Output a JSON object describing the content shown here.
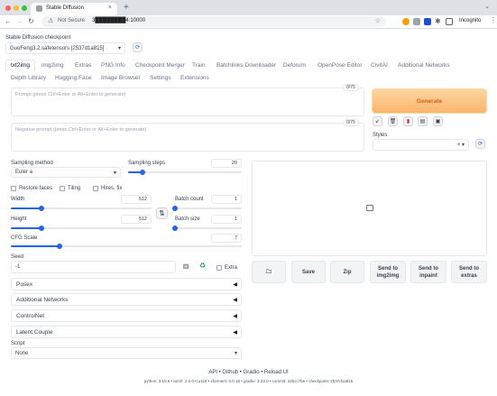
{
  "browser": {
    "tab_title": "Stable Diffusion",
    "tab_close": "×",
    "new_tab": "+",
    "security_label": "Not Secure",
    "url": "3████████4:10000",
    "profile": "Incognito",
    "icons": [
      "back-icon",
      "forward-icon",
      "reload-icon",
      "star-icon",
      "extension-icon",
      "menu-icon"
    ]
  },
  "checkpoint": {
    "label": "Stable Diffusion checkpoint",
    "value": "GuoFeng3.2.safetensors [2537d1a815]"
  },
  "tabs": {
    "row1": [
      "txt2img",
      "img2img",
      "Extras",
      "PNG Info",
      "Checkpoint Merger",
      "Train",
      "Batchlinks Downloader",
      "Deforum",
      "OpenPose Editor",
      "CivitAI",
      "Additional Networks"
    ],
    "row2": [
      "Depth Library",
      "Hugging Face",
      "Image Browser",
      "Settings",
      "Extensions"
    ],
    "active": "txt2img"
  },
  "prompt": {
    "placeholder": "Prompt (press Ctrl+Enter or Alt+Enter to generate)",
    "counter": "0/75"
  },
  "negative_prompt": {
    "placeholder": "Negative prompt (press Ctrl+Enter or Alt+Enter to generate)",
    "counter": "0/75"
  },
  "generate_label": "Generate",
  "styles": {
    "label": "Styles",
    "clear": "×",
    "arrow": "▾"
  },
  "sampling": {
    "method_label": "Sampling method",
    "method_value": "Euler a",
    "steps_label": "Sampling steps",
    "steps_value": "20",
    "steps_fraction": 0.13
  },
  "options": {
    "restore_faces": "Restore faces",
    "tiling": "Tiling",
    "hires_fix": "Hires. fix"
  },
  "size": {
    "width_label": "Width",
    "width_value": "512",
    "width_fraction": 0.22,
    "height_label": "Height",
    "height_value": "512",
    "height_fraction": 0.22,
    "swap_icon": "⇅"
  },
  "batch": {
    "count_label": "Batch count",
    "count_value": "1",
    "count_fraction": 0.0,
    "size_label": "Batch size",
    "size_value": "1",
    "size_fraction": 0.0
  },
  "cfg": {
    "label": "CFG Scale",
    "value": "7",
    "fraction": 0.21
  },
  "seed": {
    "label": "Seed",
    "value": "-1",
    "extra_label": "Extra"
  },
  "accordions": [
    "Posex",
    "Additional Networks",
    "ControlNet",
    "Latent Couple"
  ],
  "accordion_arrow": "◀",
  "script": {
    "label": "Script",
    "value": "None"
  },
  "actions": {
    "save": "Save",
    "zip": "Zip",
    "send_img2img": "Send to img2img",
    "send_inpaint": "Send to inpaint",
    "send_extras": "Send to extras"
  },
  "footer": {
    "links": "API  •  Github  •  Gradio  •  Reload UI",
    "info": "python: 3.10.6  •  torch: 2.0.0+cu118  •  xformers: 0.0.18  •  gradio: 3.23.0  •  commit: 22bcc7be  •  checkpoint: 2537d1a815"
  }
}
